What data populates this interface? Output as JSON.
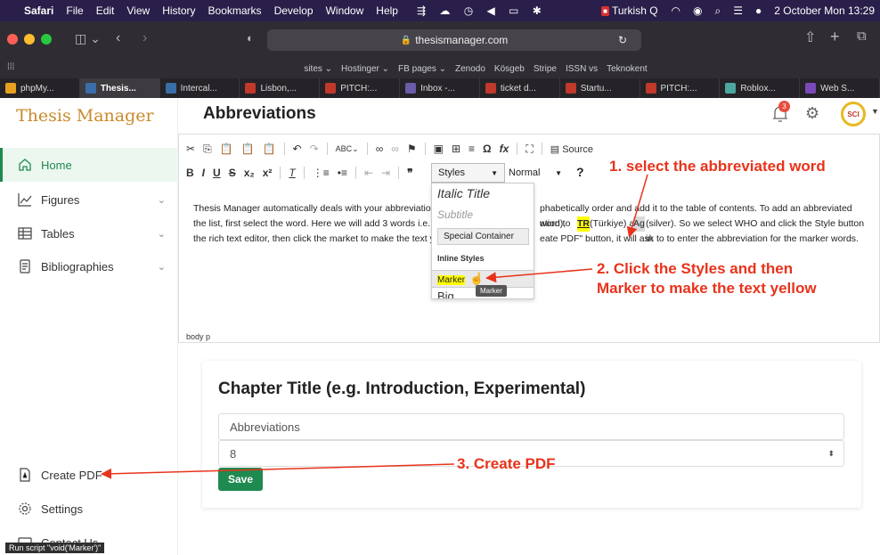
{
  "menubar": {
    "app": "Safari",
    "items": [
      "File",
      "Edit",
      "View",
      "History",
      "Bookmarks",
      "Develop",
      "Window",
      "Help"
    ],
    "flag_label": "Turkish Q",
    "datetime": "2 October Mon  13:29"
  },
  "browser": {
    "url": "thesismanager.com",
    "bookmarks": [
      "sites ⌄",
      "Hostinger ⌄",
      "FB pages ⌄",
      "Zenodo",
      "Kösgeb",
      "Stripe",
      "ISSN vs",
      "Teknokent"
    ],
    "tabs": [
      {
        "label": "phpMy...",
        "color": "#e8a020"
      },
      {
        "label": "Thesis...",
        "color": "#3a6ea8"
      },
      {
        "label": "Intercal...",
        "color": "#3a6ea8"
      },
      {
        "label": "Lisbon,...",
        "color": "#c0392b"
      },
      {
        "label": "PITCH:...",
        "color": "#c0392b"
      },
      {
        "label": "Inbox -...",
        "color": "#6c5ba8"
      },
      {
        "label": "ticket d...",
        "color": "#c0392b"
      },
      {
        "label": "Startu...",
        "color": "#c0392b"
      },
      {
        "label": "PITCH:...",
        "color": "#c0392b"
      },
      {
        "label": "Roblox...",
        "color": "#4aa8a0"
      },
      {
        "label": "Web S...",
        "color": "#7a4ab8"
      }
    ]
  },
  "sidebar": {
    "logo": "Thesis Manager",
    "items": [
      {
        "label": "Home"
      },
      {
        "label": "Figures"
      },
      {
        "label": "Tables"
      },
      {
        "label": "Bibliographies"
      }
    ],
    "bottom": [
      {
        "label": "Create PDF"
      },
      {
        "label": "Settings"
      },
      {
        "label": "Contact Us"
      }
    ]
  },
  "header": {
    "title": "Abbreviations",
    "badge": "3",
    "avatar_text": "SCI"
  },
  "editor": {
    "source_label": "Source",
    "styles_label": "Styles",
    "normal_label": "Normal",
    "body_lines": [
      "Thesis Manager automatically deals with your abbreviations",
      "phabetically order and add it to the table of contents. To add an abbreviated word to",
      "the list, first select the word. Here we will add 3 words i.e. ",
      "W",
      "ation), ",
      "TR",
      " (Türkiye) and ",
      "Ag",
      " (silver). So we select WHO and click the Style button in",
      "the rich text editor, then click the market to make the text yel",
      "eate PDF\" button, it will ask to to enter the abbreviation for the marker words."
    ],
    "dropdown": {
      "italic_title": "Italic Title",
      "subtitle": "Subtitle",
      "special": "Special Container",
      "inline_header": "Inline Styles",
      "marker": "Marker",
      "big": "Big",
      "tooltip": "Marker"
    },
    "elements_path": "body  p"
  },
  "card": {
    "title": "Chapter Title (e.g. Introduction, Experimental)",
    "abbr_value": "Abbreviations",
    "number_value": "8",
    "save_label": "Save"
  },
  "annotations": {
    "a1": "1. select the abbreviated word",
    "a2_line1": "2. Click the Styles and then",
    "a2_line2": "Marker to make the text yellow",
    "a3": "3. Create PDF",
    "accent": "#e8331c"
  },
  "status_text": "Run script \"void('Marker')\""
}
